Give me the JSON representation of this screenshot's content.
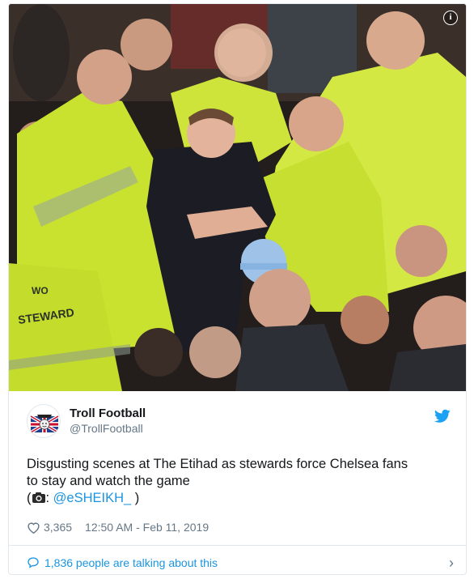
{
  "tweet": {
    "display_name": "Troll Football",
    "handle": "@TrollFootball",
    "text_line1": "Disgusting scenes at The Etihad as stewards force Chelsea fans",
    "text_line2": "to stay and watch the game",
    "credit_open": "(",
    "credit_sep": ": ",
    "credit_mention": "@eSHEIKH_",
    "credit_close": " )",
    "likes": "3,365",
    "timestamp": "12:50 AM - Feb 11, 2019",
    "talking": "1,836 people are talking about this",
    "jacket_print": "STEWARD",
    "jacket_print_small": "WO"
  },
  "icons": {
    "info": "info-icon",
    "bird": "twitter-bird-icon",
    "heart": "heart-icon",
    "bubble": "speech-bubble-icon",
    "chevron": "chevron-right-icon",
    "camera": "camera-icon"
  },
  "colors": {
    "accent": "#1b95e0",
    "muted": "#657786",
    "hi_vis": "#c6e22a"
  }
}
